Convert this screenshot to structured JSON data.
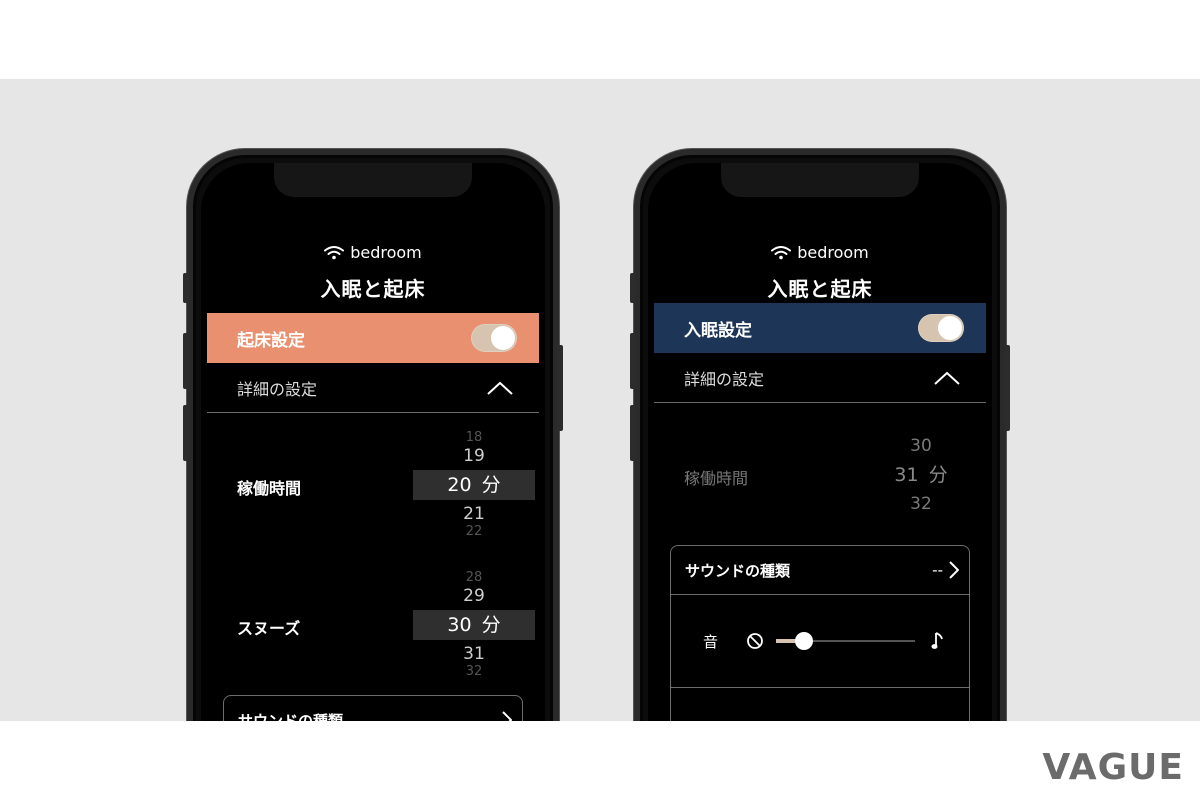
{
  "phones": [
    {
      "network": "bedroom",
      "title": "入眠と起床",
      "banner": {
        "label": "起床設定",
        "color": "#E8906F",
        "toggle_on": true
      },
      "detail_label": "詳細の設定",
      "rows": [
        {
          "label": "稼働時間",
          "picker": {
            "above_faint": "18",
            "above": "19",
            "selected": "20",
            "unit": "分",
            "below": "21",
            "below_faint": "22"
          }
        },
        {
          "label": "スヌーズ",
          "picker": {
            "above_faint": "28",
            "above": "29",
            "selected": "30",
            "unit": "分",
            "below": "31",
            "below_faint": "32"
          }
        }
      ],
      "sound_type_label": "サウンドの種類"
    },
    {
      "network": "bedroom",
      "title": "入眠と起床",
      "banner": {
        "label": "入眠設定",
        "color": "#1D3557",
        "toggle_on": true
      },
      "detail_label": "詳細の設定",
      "rows": [
        {
          "label": "稼働時間",
          "picker": {
            "above": "30",
            "selected": "31",
            "unit": "分",
            "below": "32"
          }
        }
      ],
      "sound_type_label": "サウンドの種類",
      "sound_type_value": "--",
      "volume_label": "音",
      "volume_level": 0.2
    }
  ],
  "brand": "VAGUE",
  "icons": [
    "wifi-icon",
    "chevron-up-icon",
    "chevron-right-icon",
    "mute-icon",
    "music-note-icon"
  ]
}
